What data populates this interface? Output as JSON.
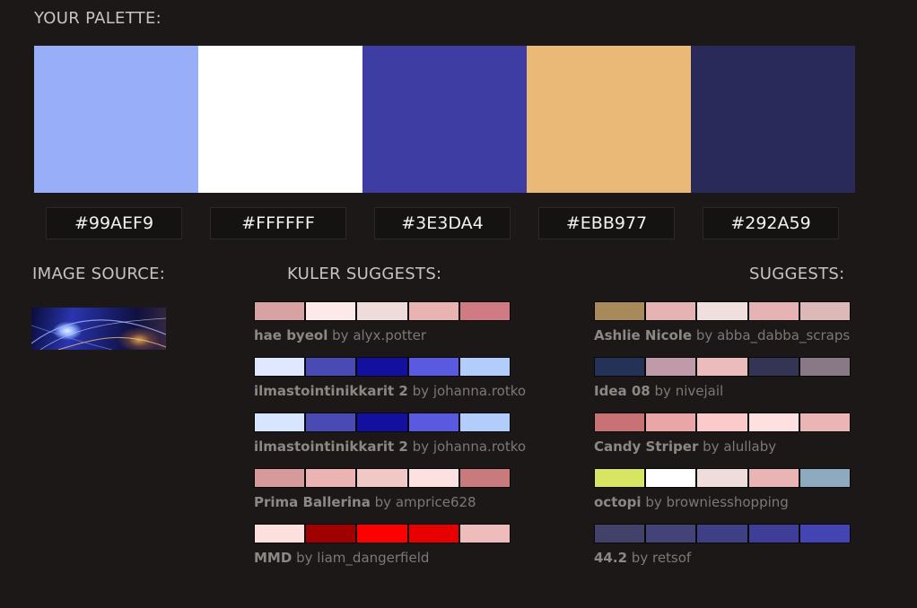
{
  "headings": {
    "palette": "YOUR PALETTE:",
    "image_source": "IMAGE SOURCE:",
    "kuler": "KULER SUGGESTS:",
    "suggests": "SUGGESTS:"
  },
  "palette": [
    {
      "hex": "#99AEF9",
      "color": "#99AEF9"
    },
    {
      "hex": "#FFFFFF",
      "color": "#FFFFFF"
    },
    {
      "hex": "#3E3DA4",
      "color": "#3E3DA4"
    },
    {
      "hex": "#EBB977",
      "color": "#EBB977"
    },
    {
      "hex": "#292A59",
      "color": "#292A59"
    }
  ],
  "kuler": [
    {
      "name": "hae byeol",
      "by": "by",
      "author": "alyx.potter",
      "colors": [
        "#d8a2a2",
        "#fde9e8",
        "#efdcda",
        "#e9b3b2",
        "#d07a83"
      ]
    },
    {
      "name": "ilmastointinikkarit 2",
      "by": "by",
      "author": "johanna.rotko",
      "colors": [
        "#dfe8ff",
        "#4a4ab4",
        "#13109f",
        "#5a5ae0",
        "#b2cdfc"
      ]
    },
    {
      "name": "ilmastointinikkarit 2",
      "by": "by",
      "author": "johanna.rotko",
      "colors": [
        "#d8e5ff",
        "#4a4ab4",
        "#13109f",
        "#5a5ae0",
        "#b2cdfc"
      ]
    },
    {
      "name": "Prima Ballerina",
      "by": "by",
      "author": "amprice628",
      "colors": [
        "#d69a9b",
        "#ebb3b2",
        "#f0c8c6",
        "#fde0e0",
        "#c97a7c"
      ]
    },
    {
      "name": "MMD",
      "by": "by",
      "author": "liam_dangerfield",
      "colors": [
        "#fde0de",
        "#a00000",
        "#fe0000",
        "#e60000",
        "#eebcbb"
      ]
    }
  ],
  "suggests": [
    {
      "name": "Ashlie Nicole",
      "by": "by",
      "author": "abba_dabba_scraps",
      "colors": [
        "#a8895a",
        "#e7b2b3",
        "#f1dfde",
        "#e7b2b3",
        "#dcb8b8"
      ]
    },
    {
      "name": "Idea 08",
      "by": "by",
      "author": "nivejail",
      "colors": [
        "#253257",
        "#c09aa8",
        "#ecbbbc",
        "#343455",
        "#897886"
      ]
    },
    {
      "name": "Candy Striper",
      "by": "by",
      "author": "alullaby",
      "colors": [
        "#c97275",
        "#eaa6a7",
        "#fdcacc",
        "#ffe0e1",
        "#ebb5b6"
      ]
    },
    {
      "name": "octopi",
      "by": "by",
      "author": "browniesshopping",
      "colors": [
        "#d8e562",
        "#ffffff",
        "#efdddc",
        "#eab4b4",
        "#8daabf"
      ]
    },
    {
      "name": "44.2",
      "by": "by",
      "author": "retsof",
      "colors": [
        "#414169",
        "#434377",
        "#3f3f86",
        "#3e3e98",
        "#4444b3"
      ]
    }
  ]
}
